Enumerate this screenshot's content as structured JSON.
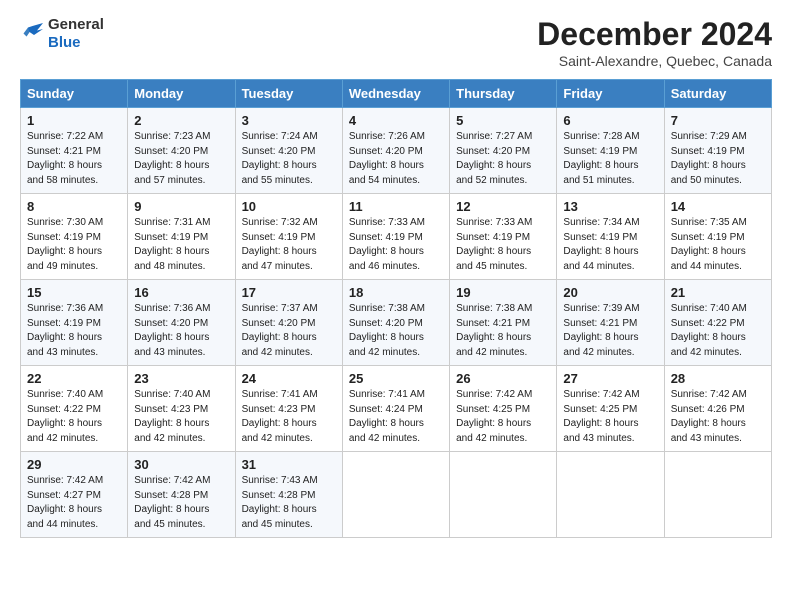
{
  "logo": {
    "line1": "General",
    "line2": "Blue"
  },
  "title": "December 2024",
  "location": "Saint-Alexandre, Quebec, Canada",
  "days_of_week": [
    "Sunday",
    "Monday",
    "Tuesday",
    "Wednesday",
    "Thursday",
    "Friday",
    "Saturday"
  ],
  "weeks": [
    [
      {
        "day": 1,
        "sunrise": "7:22 AM",
        "sunset": "4:21 PM",
        "daylight": "8 hours and 58 minutes."
      },
      {
        "day": 2,
        "sunrise": "7:23 AM",
        "sunset": "4:20 PM",
        "daylight": "8 hours and 57 minutes."
      },
      {
        "day": 3,
        "sunrise": "7:24 AM",
        "sunset": "4:20 PM",
        "daylight": "8 hours and 55 minutes."
      },
      {
        "day": 4,
        "sunrise": "7:26 AM",
        "sunset": "4:20 PM",
        "daylight": "8 hours and 54 minutes."
      },
      {
        "day": 5,
        "sunrise": "7:27 AM",
        "sunset": "4:20 PM",
        "daylight": "8 hours and 52 minutes."
      },
      {
        "day": 6,
        "sunrise": "7:28 AM",
        "sunset": "4:19 PM",
        "daylight": "8 hours and 51 minutes."
      },
      {
        "day": 7,
        "sunrise": "7:29 AM",
        "sunset": "4:19 PM",
        "daylight": "8 hours and 50 minutes."
      }
    ],
    [
      {
        "day": 8,
        "sunrise": "7:30 AM",
        "sunset": "4:19 PM",
        "daylight": "8 hours and 49 minutes."
      },
      {
        "day": 9,
        "sunrise": "7:31 AM",
        "sunset": "4:19 PM",
        "daylight": "8 hours and 48 minutes."
      },
      {
        "day": 10,
        "sunrise": "7:32 AM",
        "sunset": "4:19 PM",
        "daylight": "8 hours and 47 minutes."
      },
      {
        "day": 11,
        "sunrise": "7:33 AM",
        "sunset": "4:19 PM",
        "daylight": "8 hours and 46 minutes."
      },
      {
        "day": 12,
        "sunrise": "7:33 AM",
        "sunset": "4:19 PM",
        "daylight": "8 hours and 45 minutes."
      },
      {
        "day": 13,
        "sunrise": "7:34 AM",
        "sunset": "4:19 PM",
        "daylight": "8 hours and 44 minutes."
      },
      {
        "day": 14,
        "sunrise": "7:35 AM",
        "sunset": "4:19 PM",
        "daylight": "8 hours and 44 minutes."
      }
    ],
    [
      {
        "day": 15,
        "sunrise": "7:36 AM",
        "sunset": "4:19 PM",
        "daylight": "8 hours and 43 minutes."
      },
      {
        "day": 16,
        "sunrise": "7:36 AM",
        "sunset": "4:20 PM",
        "daylight": "8 hours and 43 minutes."
      },
      {
        "day": 17,
        "sunrise": "7:37 AM",
        "sunset": "4:20 PM",
        "daylight": "8 hours and 42 minutes."
      },
      {
        "day": 18,
        "sunrise": "7:38 AM",
        "sunset": "4:20 PM",
        "daylight": "8 hours and 42 minutes."
      },
      {
        "day": 19,
        "sunrise": "7:38 AM",
        "sunset": "4:21 PM",
        "daylight": "8 hours and 42 minutes."
      },
      {
        "day": 20,
        "sunrise": "7:39 AM",
        "sunset": "4:21 PM",
        "daylight": "8 hours and 42 minutes."
      },
      {
        "day": 21,
        "sunrise": "7:40 AM",
        "sunset": "4:22 PM",
        "daylight": "8 hours and 42 minutes."
      }
    ],
    [
      {
        "day": 22,
        "sunrise": "7:40 AM",
        "sunset": "4:22 PM",
        "daylight": "8 hours and 42 minutes."
      },
      {
        "day": 23,
        "sunrise": "7:40 AM",
        "sunset": "4:23 PM",
        "daylight": "8 hours and 42 minutes."
      },
      {
        "day": 24,
        "sunrise": "7:41 AM",
        "sunset": "4:23 PM",
        "daylight": "8 hours and 42 minutes."
      },
      {
        "day": 25,
        "sunrise": "7:41 AM",
        "sunset": "4:24 PM",
        "daylight": "8 hours and 42 minutes."
      },
      {
        "day": 26,
        "sunrise": "7:42 AM",
        "sunset": "4:25 PM",
        "daylight": "8 hours and 42 minutes."
      },
      {
        "day": 27,
        "sunrise": "7:42 AM",
        "sunset": "4:25 PM",
        "daylight": "8 hours and 43 minutes."
      },
      {
        "day": 28,
        "sunrise": "7:42 AM",
        "sunset": "4:26 PM",
        "daylight": "8 hours and 43 minutes."
      }
    ],
    [
      {
        "day": 29,
        "sunrise": "7:42 AM",
        "sunset": "4:27 PM",
        "daylight": "8 hours and 44 minutes."
      },
      {
        "day": 30,
        "sunrise": "7:42 AM",
        "sunset": "4:28 PM",
        "daylight": "8 hours and 45 minutes."
      },
      {
        "day": 31,
        "sunrise": "7:43 AM",
        "sunset": "4:28 PM",
        "daylight": "8 hours and 45 minutes."
      },
      null,
      null,
      null,
      null
    ]
  ]
}
